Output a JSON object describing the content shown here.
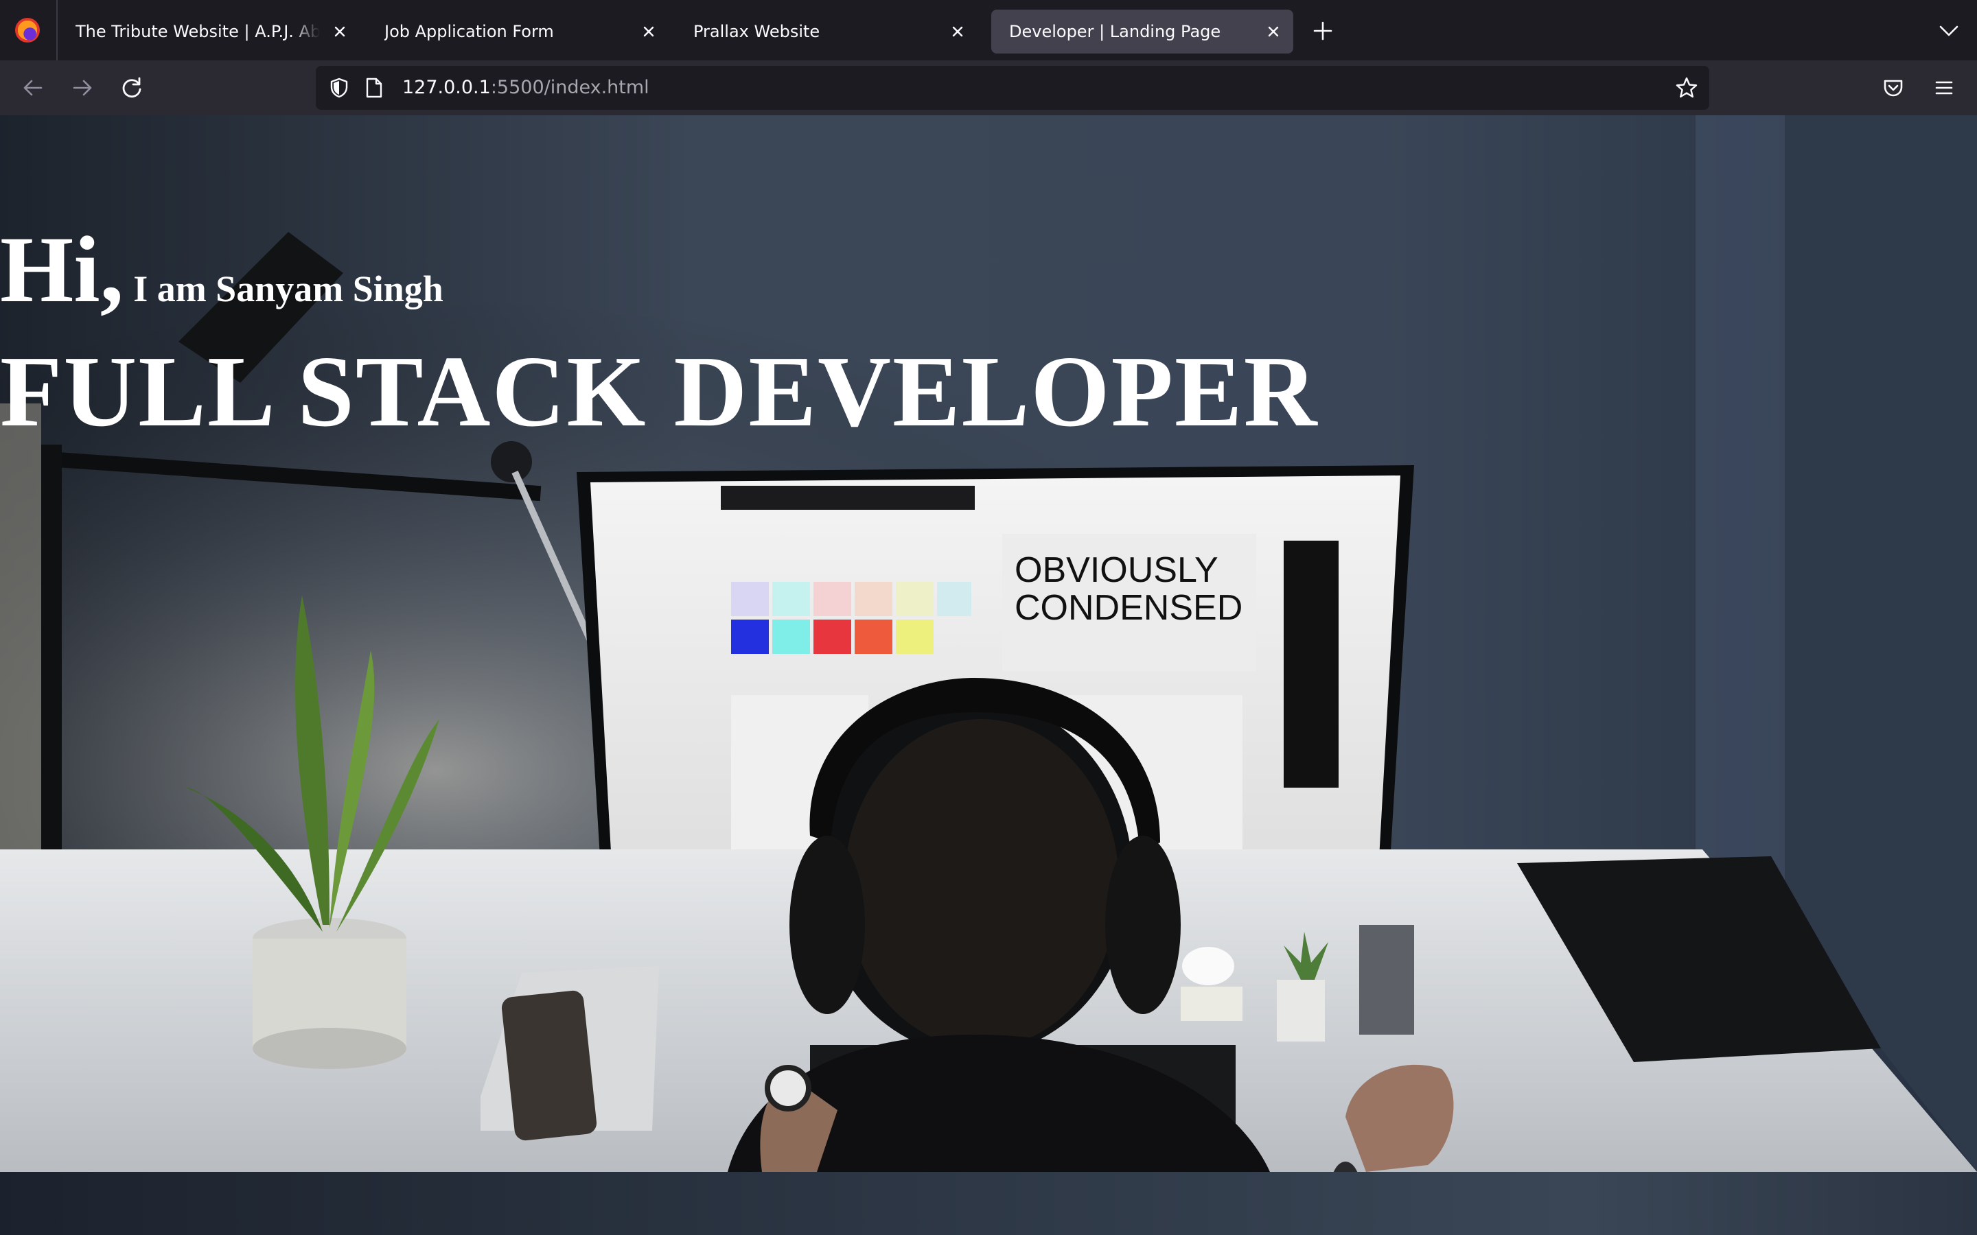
{
  "browser": {
    "tabs": [
      {
        "label": "The Tribute Website | A.P.J. Abdul Kalam",
        "active": false
      },
      {
        "label": "Job Application Form",
        "active": false
      },
      {
        "label": "Prallax Website",
        "active": false
      },
      {
        "label": "Developer | Landing Page",
        "active": true
      }
    ],
    "url": {
      "host": "127.0.0.1",
      "path": ":5500/index.html"
    },
    "icons": {
      "app": "firefox-logo-icon",
      "new_tab": "plus-icon",
      "tab_list": "chevron-down-icon",
      "back": "arrow-left-icon",
      "forward": "arrow-right-icon",
      "reload": "reload-icon",
      "security": "shield-icon",
      "page": "page-icon",
      "bookmark": "star-icon",
      "pocket": "pocket-icon",
      "menu": "hamburger-menu-icon"
    },
    "colors": {
      "chrome_bg": "#1c1b22",
      "toolbar_bg": "#2b2a33",
      "active_tab": "#42414d",
      "text": "#fbfbfe"
    }
  },
  "page": {
    "greeting": "Hi,",
    "intro": "I am Sanyam Singh",
    "role": "FULL STACK DEVELOPER",
    "background_image": "developer-desk-photo"
  }
}
